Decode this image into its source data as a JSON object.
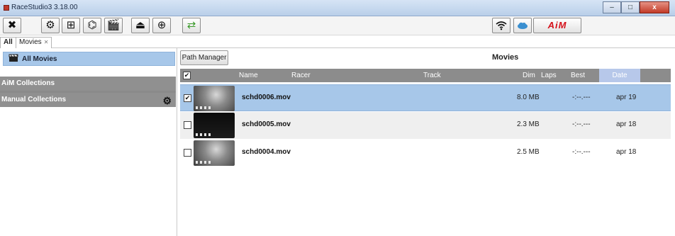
{
  "window": {
    "title": "RaceStudio3 3.18.00",
    "controls": {
      "minimize": "–",
      "maximize": "□",
      "close": "x"
    }
  },
  "toolbar": {
    "buttons": [
      {
        "name": "tools-icon",
        "glyph": "✖"
      },
      {
        "name": "settings-gear-icon",
        "glyph": "⚙"
      },
      {
        "name": "dashboard-icon",
        "glyph": "⊞"
      },
      {
        "name": "track-map-icon",
        "glyph": "⌬"
      },
      {
        "name": "movies-clapper-icon",
        "glyph": "🎬"
      },
      {
        "name": "download-icon",
        "glyph": "⏏"
      },
      {
        "name": "add-device-icon",
        "glyph": "⊕"
      },
      {
        "name": "transfer-icon",
        "glyph": "⇄"
      }
    ],
    "wifi_icon": "wifi-icon",
    "cloud_icon": "cloud-icon",
    "logo_text": "AiM"
  },
  "tabs": [
    {
      "label": "All"
    },
    {
      "label": "Movies",
      "close": "✕"
    }
  ],
  "sidebar": {
    "all_movies": "All Movies",
    "aim_collections": "AiM Collections",
    "manual_collections": "Manual Collections"
  },
  "main": {
    "path_manager": "Path Manager",
    "section_title": "Movies",
    "columns": {
      "name": "Name",
      "racer": "Racer",
      "track": "Track",
      "dim": "Dim",
      "laps": "Laps",
      "best": "Best",
      "date": "Date"
    },
    "header_checked": true,
    "rows": [
      {
        "checked": true,
        "name": "schd0006.mov",
        "dim": "8.0 MB",
        "best": "-:--.---",
        "date": "apr 19",
        "selected": true
      },
      {
        "checked": false,
        "name": "schd0005.mov",
        "dim": "2.3 MB",
        "best": "-:--.---",
        "date": "apr 18",
        "selected": false
      },
      {
        "checked": false,
        "name": "schd0004.mov",
        "dim": "2.5 MB",
        "best": "-:--.---",
        "date": "apr 18",
        "selected": false
      }
    ]
  },
  "colors": {
    "selection": "#a7c7e9",
    "header_gray": "#8c8c8c",
    "date_header_active": "#b7c8ea",
    "logo_red": "#d5101a"
  }
}
